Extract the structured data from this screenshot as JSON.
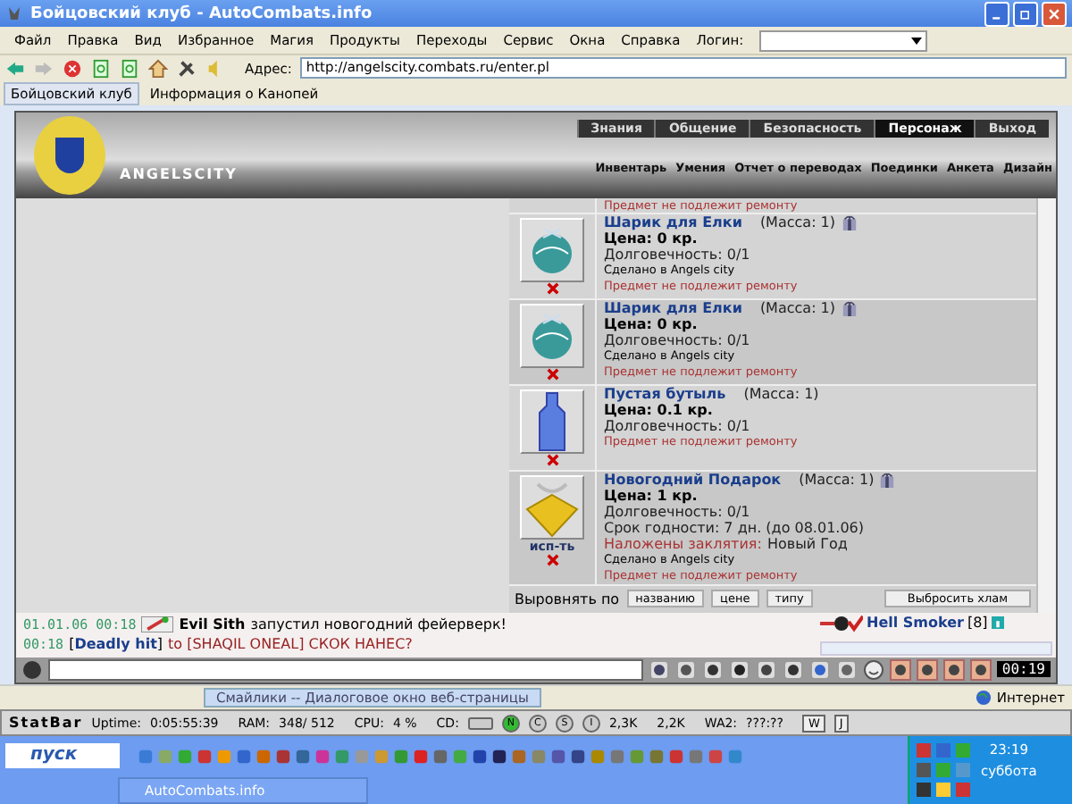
{
  "window": {
    "title": "Бойцовский клуб - AutoCombats.info"
  },
  "menu": [
    "Файл",
    "Правка",
    "Вид",
    "Избранное",
    "Магия",
    "Продукты",
    "Переходы",
    "Сервис",
    "Окна",
    "Справка"
  ],
  "login": {
    "label": "Логин:"
  },
  "address": {
    "label": "Адрес:",
    "url": "http://angelscity.combats.ru/enter.pl"
  },
  "tabs": [
    {
      "label": "Бойцовский клуб",
      "selected": true
    },
    {
      "label": "Информация о Канопей",
      "selected": false
    }
  ],
  "site": {
    "logo_text": "ANGELSCITY",
    "top_nav": [
      {
        "label": "Знания",
        "selected": false
      },
      {
        "label": "Общение",
        "selected": false
      },
      {
        "label": "Безопасность",
        "selected": false
      },
      {
        "label": "Персонаж",
        "selected": true
      },
      {
        "label": "Выход",
        "selected": false
      }
    ],
    "sub_nav": [
      "Инвентарь",
      "Умения",
      "Отчет о переводах",
      "Поединки",
      "Анкета",
      "Дизайн"
    ]
  },
  "inventory": {
    "partial_repair": "Предмет не подлежит ремонту",
    "items": [
      {
        "kind": "ornament",
        "name": "Шарик для Елки",
        "mass": "(Масса: 1)",
        "gift": true,
        "price": "Цена: 0 кр.",
        "durability": "Долговечность: 0/1",
        "made": "Сделано в Angels city",
        "repair": "Предмет не подлежит ремонту"
      },
      {
        "kind": "ornament",
        "name": "Шарик для Елки",
        "mass": "(Масса: 1)",
        "gift": true,
        "price": "Цена: 0 кр.",
        "durability": "Долговечность: 0/1",
        "made": "Сделано в Angels city",
        "repair": "Предмет не подлежит ремонту"
      },
      {
        "kind": "bottle",
        "name": "Пустая бутыль",
        "mass": "(Масса: 1)",
        "gift": false,
        "price": "Цена: 0.1 кр.",
        "durability": "Долговечность: 0/1",
        "repair": "Предмет не подлежит ремонту"
      },
      {
        "kind": "present",
        "name": "Новогодний Подарок",
        "mass": "(Масса: 1)",
        "gift": true,
        "price": "Цена: 1 кр.",
        "durability": "Долговечность: 0/1",
        "expiry": "Срок годности: 7 дн. (до 08.01.06)",
        "spell_label": "Наложены заклятия:",
        "spell": "Новый Год",
        "made": "Сделано в Angels city",
        "repair": "Предмет не подлежит ремонту",
        "action": "исп-ть"
      }
    ],
    "sort_label": "Выровнять по",
    "sort_buttons": [
      "названию",
      "цене",
      "типу"
    ],
    "discard": "Выбросить хлам"
  },
  "chat": {
    "messages": [
      {
        "kind": "system",
        "time": "01.01.06 00:18",
        "sender": "Evil Sith",
        "text": "запустил новогодний фейерверк!"
      },
      {
        "kind": "private",
        "time": "00:18",
        "sender": "[**Deadly hit**]",
        "text": "to [SHAQIL ONEAL] СКОК НАНЕС?"
      }
    ],
    "online": {
      "name": "Hell Smoker",
      "level": "[8]"
    },
    "clock": "00:19"
  },
  "status_bar": {
    "popup": "Смайлики -- Диалоговое окно веб-страницы",
    "zone": "Интернет"
  },
  "statbar": {
    "title": "StatBar",
    "fields": [
      {
        "label": "Uptime:",
        "value": "0:05:55:39"
      },
      {
        "label": "RAM:",
        "value": "348/ 512"
      },
      {
        "label": "CPU:",
        "value": "4 %"
      },
      {
        "label": "CD:"
      }
    ],
    "leds": [
      "N",
      "C",
      "S",
      "I"
    ],
    "down": "2,3K",
    "up": "2,2K",
    "wa_label": "WA2:",
    "wa_value": "???:??",
    "wa_buttons": [
      "W",
      "J"
    ]
  },
  "taskbar": {
    "start": "пуск",
    "task": "AutoCombats.info",
    "time": "23:19",
    "day": "суббота"
  }
}
